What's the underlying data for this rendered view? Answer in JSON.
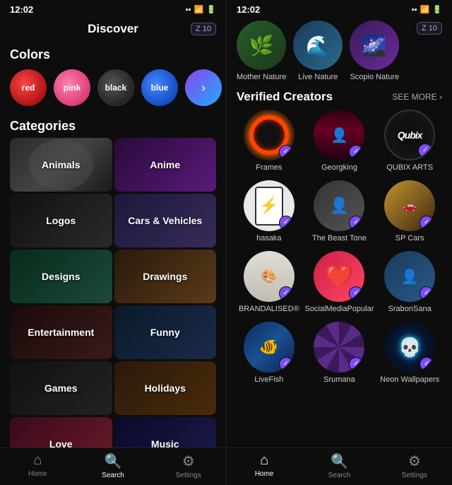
{
  "left": {
    "status": {
      "time": "12:02",
      "icons": "▪ ▪ ▫"
    },
    "header": {
      "title": "Discover",
      "badge": "Z 10"
    },
    "colors": {
      "section_label": "Colors",
      "items": [
        {
          "name": "red",
          "class": "red"
        },
        {
          "name": "pink",
          "class": "pink"
        },
        {
          "name": "black",
          "class": "black"
        },
        {
          "name": "blue",
          "class": "blue"
        }
      ]
    },
    "categories": {
      "section_label": "Categories",
      "items": [
        {
          "name": "Animals",
          "class": "cat-animals"
        },
        {
          "name": "Anime",
          "class": "cat-anime"
        },
        {
          "name": "Logos",
          "class": "cat-logos"
        },
        {
          "name": "Cars & Vehicles",
          "class": "cat-cars"
        },
        {
          "name": "Designs",
          "class": "cat-designs"
        },
        {
          "name": "Drawings",
          "class": "cat-drawings"
        },
        {
          "name": "Entertainment",
          "class": "cat-entertainment"
        },
        {
          "name": "Funny",
          "class": "cat-funny"
        },
        {
          "name": "Games",
          "class": "cat-games"
        },
        {
          "name": "Holidays",
          "class": "cat-holidays"
        },
        {
          "name": "Love",
          "class": "cat-love"
        },
        {
          "name": "Music",
          "class": "cat-music"
        }
      ]
    },
    "nav": {
      "items": [
        {
          "label": "Home",
          "icon": "⌂",
          "active": false
        },
        {
          "label": "Search",
          "icon": "⌕",
          "active": true
        },
        {
          "label": "Settings",
          "icon": "⚙",
          "active": false
        }
      ]
    }
  },
  "right": {
    "status": {
      "time": "12:02"
    },
    "badge": "Z 10",
    "nature_items": [
      {
        "label": "Mother Nature"
      },
      {
        "label": "Live Nature"
      },
      {
        "label": "Scopio Nature"
      }
    ],
    "verified": {
      "title": "Verified Creators",
      "see_more": "SEE MORE ›"
    },
    "creators": [
      {
        "name": "Frames",
        "av_class": "av-frames"
      },
      {
        "name": "Georgking",
        "av_class": "av-georgking"
      },
      {
        "name": "QUBIX ARTS",
        "av_class": "av-qubix"
      },
      {
        "name": "hasaka",
        "av_class": "av-hasaka"
      },
      {
        "name": "The Beast Tone",
        "av_class": "av-beast"
      },
      {
        "name": "SP Cars",
        "av_class": "av-spcars"
      },
      {
        "name": "BRANDALISED®",
        "av_class": "av-brandalised"
      },
      {
        "name": "SocialMediaPopular",
        "av_class": "av-social"
      },
      {
        "name": "SrabonSana",
        "av_class": "av-srabon"
      },
      {
        "name": "LiveFish",
        "av_class": "av-livefish"
      },
      {
        "name": "Srumana",
        "av_class": "av-srumana"
      },
      {
        "name": "Neon Wallpapers",
        "av_class": "av-neon"
      }
    ],
    "nav": {
      "items": [
        {
          "label": "Home",
          "icon": "⌂",
          "active": true
        },
        {
          "label": "Search",
          "icon": "⌕",
          "active": false
        },
        {
          "label": "Settings",
          "icon": "⚙",
          "active": false
        }
      ]
    }
  }
}
